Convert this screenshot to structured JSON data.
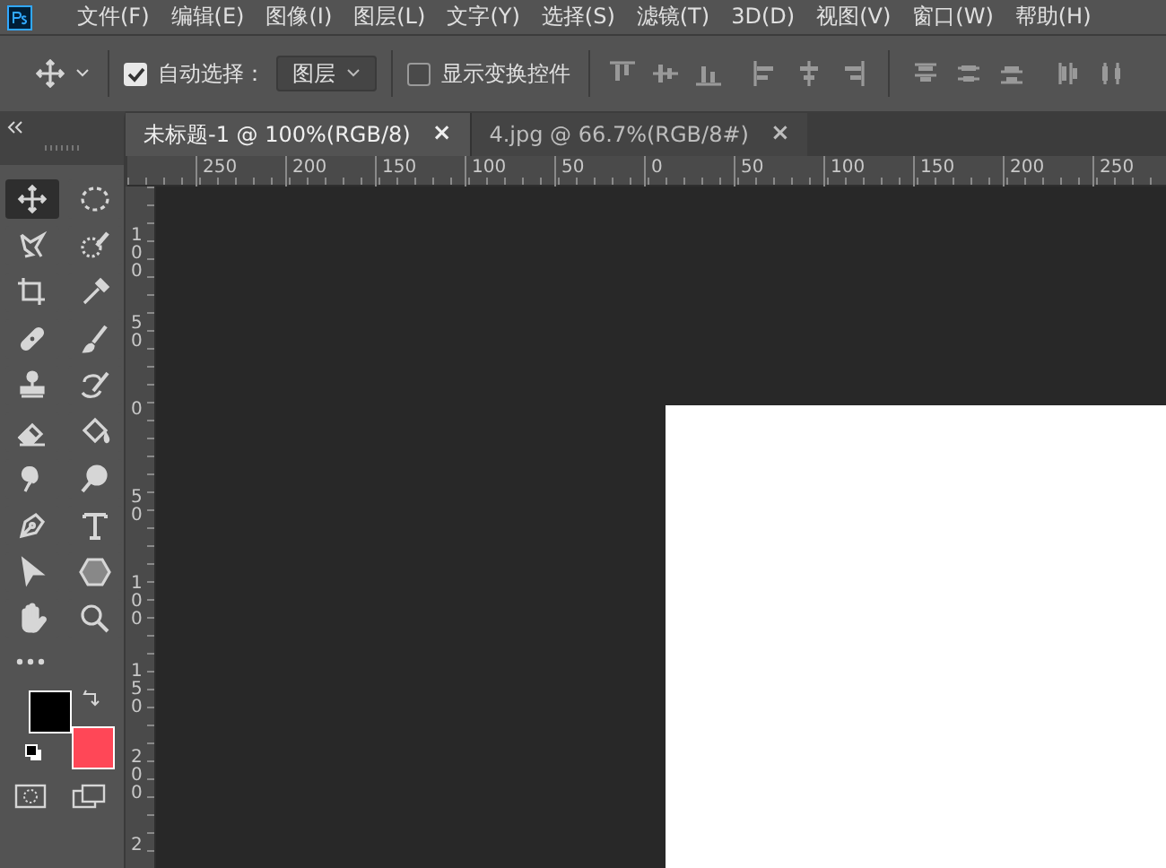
{
  "menu_bar": {
    "items": [
      "文件(F)",
      "编辑(E)",
      "图像(I)",
      "图层(L)",
      "文字(Y)",
      "选择(S)",
      "滤镜(T)",
      "3D(D)",
      "视图(V)",
      "窗口(W)",
      "帮助(H)"
    ]
  },
  "options_bar": {
    "auto_select": {
      "label": "自动选择：",
      "checked": true
    },
    "auto_select_target": {
      "value": "图层"
    },
    "show_transform_controls": {
      "label": "显示变换控件",
      "checked": false
    }
  },
  "tabs": [
    {
      "label": "未标题-1 @ 100%(RGB/8)",
      "close": "×",
      "selected": true
    },
    {
      "label": "4.jpg @ 66.7%(RGB/8#)",
      "close": "×",
      "selected": false
    }
  ],
  "horizontal_ruler": {
    "labels": [
      "250",
      "200",
      "150",
      "100",
      "50",
      "0",
      "50",
      "100",
      "150",
      "200",
      "250"
    ]
  },
  "vertical_ruler": {
    "labels": [
      "100",
      "50",
      "0",
      "50",
      "100",
      "150",
      "200",
      "2"
    ]
  },
  "toolbar": {
    "tools": [
      {
        "selected": true
      },
      {
        "selected": false
      },
      {
        "selected": false
      },
      {
        "selected": false
      },
      {
        "selected": false
      },
      {
        "selected": false
      },
      {
        "selected": false
      },
      {
        "selected": false
      },
      {
        "selected": false
      },
      {
        "selected": false
      },
      {
        "selected": false
      },
      {
        "selected": false
      },
      {
        "selected": false
      },
      {
        "selected": false
      },
      {
        "selected": false
      },
      {
        "selected": false
      },
      {
        "selected": false
      },
      {
        "selected": false
      },
      {
        "selected": false
      },
      {
        "selected": false
      }
    ],
    "foreground_color": {
      "color": "#000000"
    },
    "background_color": {
      "color": "#ff4757"
    }
  }
}
